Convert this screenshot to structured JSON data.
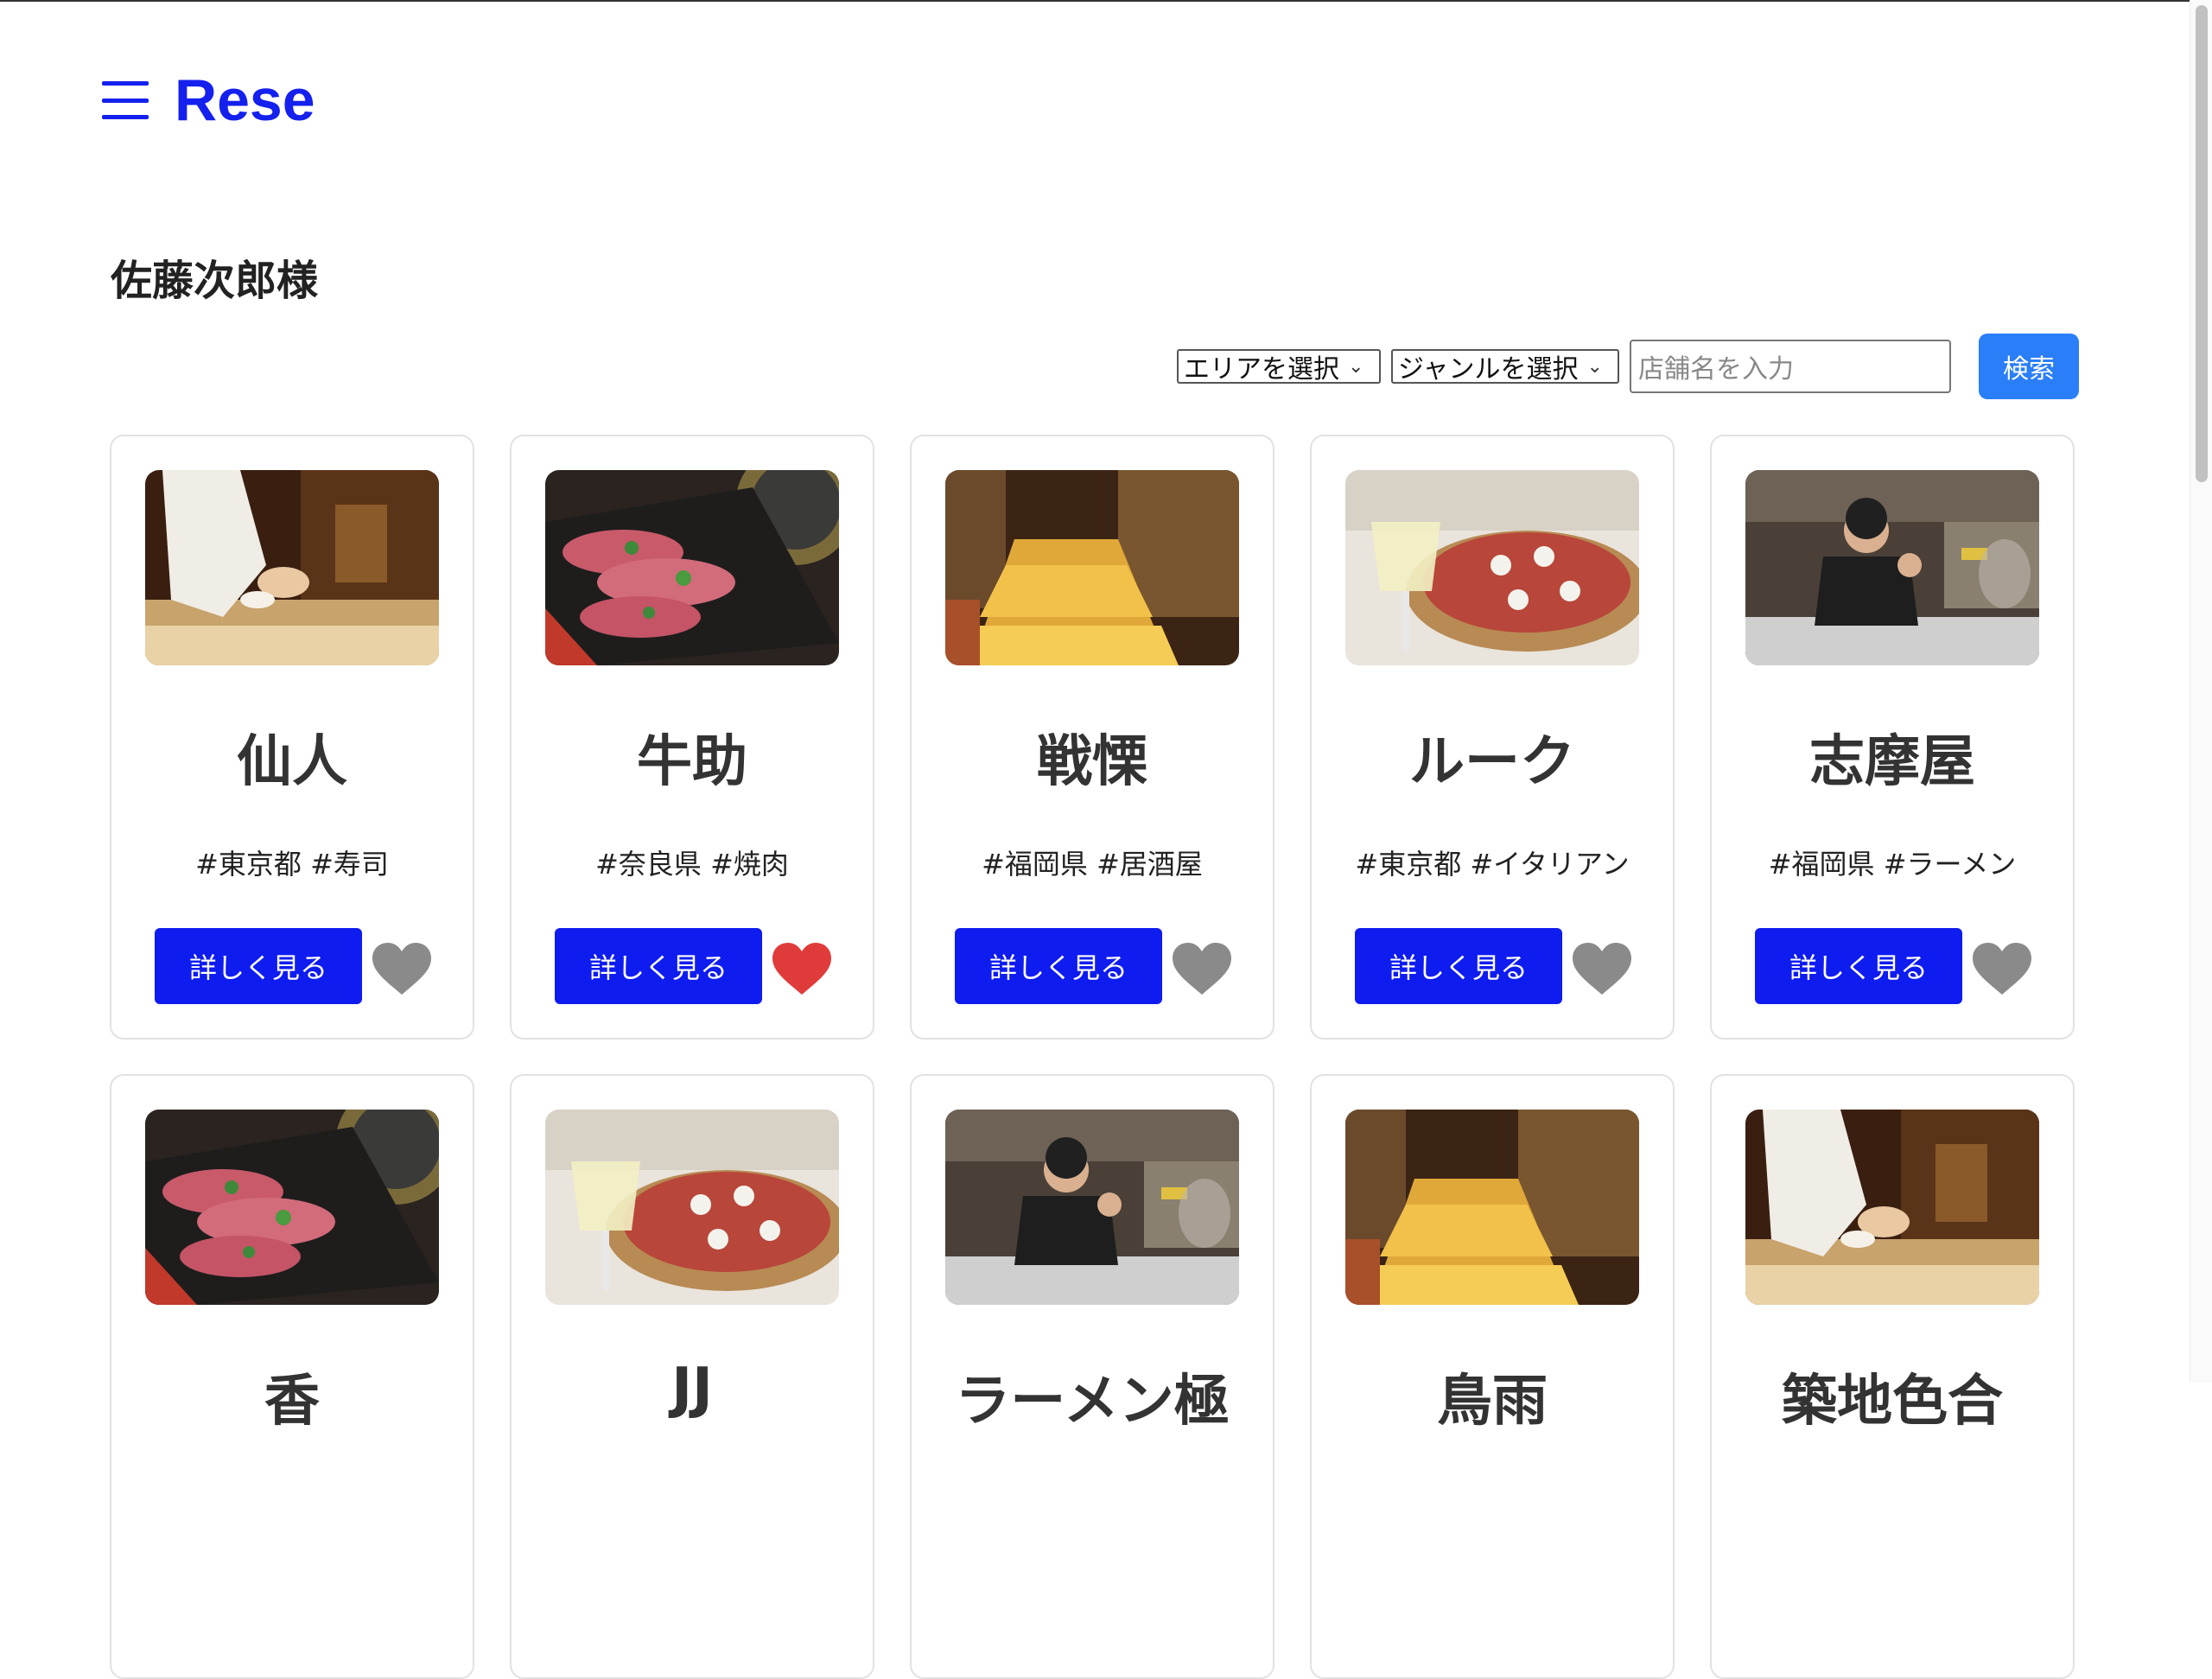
{
  "app": {
    "logo": "Rese"
  },
  "user": {
    "greeting": "佐藤次郎様"
  },
  "search": {
    "area_label": "エリアを選択",
    "genre_label": "ジャンルを選択",
    "placeholder": "店舗名を入力",
    "button_label": "検索"
  },
  "colors": {
    "brand": "#1420ee",
    "search_button": "#2a7ef8",
    "favorite_on": "#e03b3b",
    "favorite_off": "#8a8a8a"
  },
  "shops": [
    {
      "name": "仙人",
      "tags": "#東京都 #寿司",
      "button": "詳しく見る",
      "favorite": false,
      "image": "sushi-chef"
    },
    {
      "name": "牛助",
      "tags": "#奈良県 #焼肉",
      "button": "詳しく見る",
      "favorite": true,
      "image": "yakiniku-beef"
    },
    {
      "name": "戦慄",
      "tags": "#福岡県 #居酒屋",
      "button": "詳しく見る",
      "favorite": false,
      "image": "izakaya-interior"
    },
    {
      "name": "ルーク",
      "tags": "#東京都 #イタリアン",
      "button": "詳しく見る",
      "favorite": false,
      "image": "pizza-wine"
    },
    {
      "name": "志摩屋",
      "tags": "#福岡県 #ラーメン",
      "button": "詳しく見る",
      "favorite": false,
      "image": "ramen-kitchen"
    },
    {
      "name": "香",
      "tags": "",
      "button": "",
      "favorite": false,
      "image": "yakiniku-beef"
    },
    {
      "name": "JJ",
      "tags": "",
      "button": "",
      "favorite": false,
      "image": "pizza-wine"
    },
    {
      "name": "ラーメン極",
      "tags": "",
      "button": "",
      "favorite": false,
      "image": "ramen-kitchen"
    },
    {
      "name": "鳥雨",
      "tags": "",
      "button": "",
      "favorite": false,
      "image": "izakaya-interior"
    },
    {
      "name": "築地色合",
      "tags": "",
      "button": "",
      "favorite": false,
      "image": "sushi-chef"
    }
  ]
}
